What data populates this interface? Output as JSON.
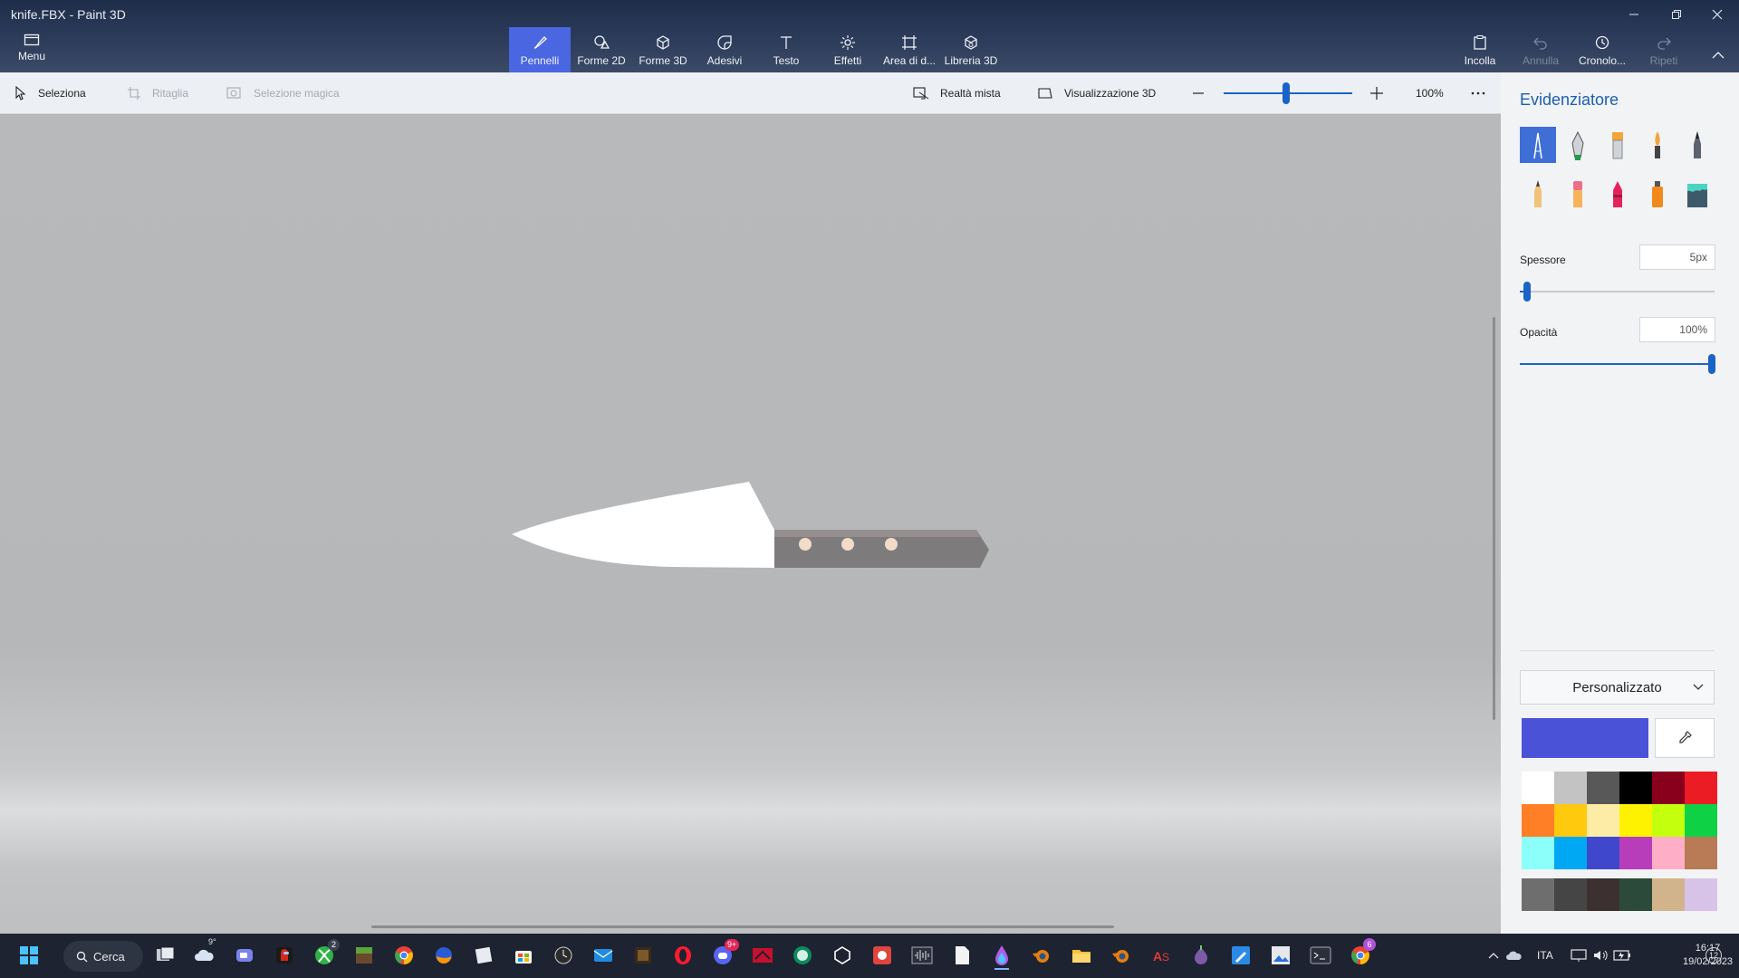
{
  "window": {
    "title": "knife.FBX - Paint 3D"
  },
  "ribbon": {
    "menu_label": "Menu",
    "tools": [
      {
        "label": "Pennelli",
        "active": true
      },
      {
        "label": "Forme 2D"
      },
      {
        "label": "Forme 3D"
      },
      {
        "label": "Adesivi"
      },
      {
        "label": "Testo"
      },
      {
        "label": "Effetti"
      },
      {
        "label": "Area di d..."
      },
      {
        "label": "Libreria 3D"
      }
    ],
    "paste_label": "Incolla",
    "undo_label": "Annulla",
    "history_label": "Cronolo...",
    "redo_label": "Ripeti"
  },
  "subbar": {
    "select_label": "Seleziona",
    "crop_label": "Ritaglia",
    "magic_select_label": "Selezione magica",
    "mixed_reality_label": "Realtà mista",
    "view3d_label": "Visualizzazione 3D",
    "zoom_value": "100%",
    "zoom_level": 0.5
  },
  "panel": {
    "title": "Evidenziatore",
    "brushes": [
      "marker",
      "calligraphy-pen",
      "oil-brush",
      "watercolor",
      "pixel-pen",
      "pencil",
      "eraser",
      "crayon",
      "spray-can",
      "fill"
    ],
    "thickness_label": "Spessore",
    "thickness_value": "5px",
    "thickness_level": 0.05,
    "opacity_label": "Opacità",
    "opacity_value": "100%",
    "opacity_level": 1.0,
    "palette_dropdown": "Personalizzato",
    "current_color": "#4a52d8",
    "palette": [
      "#ffffff",
      "#c3c3c3",
      "#585858",
      "#000000",
      "#88001b",
      "#ec1c24",
      "#ff7f27",
      "#ffc90e",
      "#fdeca6",
      "#fff200",
      "#c4ff0e",
      "#0ed145",
      "#8cfffb",
      "#00a8f3",
      "#3f48cc",
      "#b83dba",
      "#ffaec8",
      "#b97a56"
    ],
    "custom_colors": [
      "#6e6e6e",
      "#454545",
      "#3d3030",
      "#2c4a3a",
      "#d2b48c",
      "#d8c3e8"
    ]
  },
  "taskbar": {
    "search_label": "Cerca",
    "weather_temp": "9°",
    "xbox_badge": "2",
    "discord_badge": "9+",
    "chrome_badge": "6",
    "language": "ITA",
    "time": "16:17",
    "date": "19/02/2023",
    "notif_count": "12"
  }
}
